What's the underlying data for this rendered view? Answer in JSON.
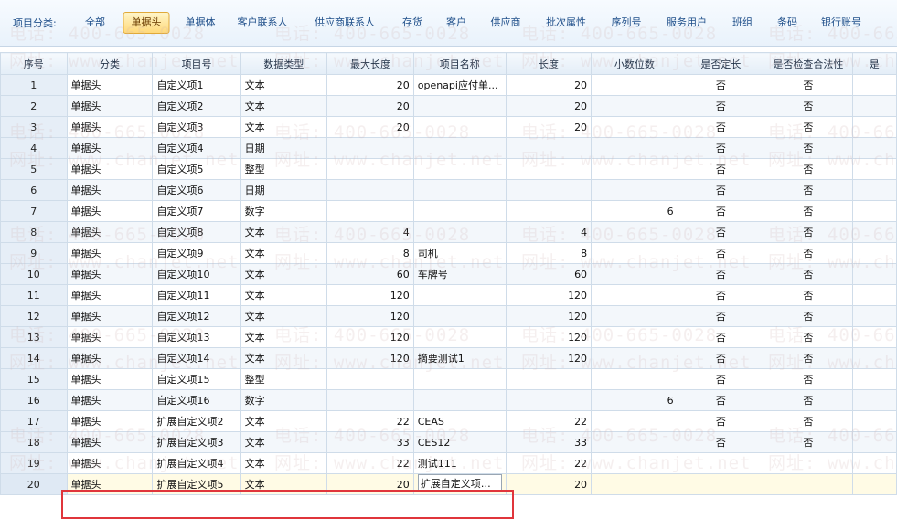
{
  "category_bar": {
    "label": "项目分类:",
    "items": [
      {
        "label": "全部",
        "active": false
      },
      {
        "label": "单据头",
        "active": true
      },
      {
        "label": "单据体",
        "active": false
      },
      {
        "label": "客户联系人",
        "active": false
      },
      {
        "label": "供应商联系人",
        "active": false
      },
      {
        "label": "存货",
        "active": false
      },
      {
        "label": "客户",
        "active": false
      },
      {
        "label": "供应商",
        "active": false
      },
      {
        "label": "批次属性",
        "active": false
      },
      {
        "label": "序列号",
        "active": false
      },
      {
        "label": "服务用户",
        "active": false
      },
      {
        "label": "班组",
        "active": false
      },
      {
        "label": "条码",
        "active": false
      },
      {
        "label": "银行账号",
        "active": false
      }
    ]
  },
  "grid": {
    "columns": [
      "序号",
      "分类",
      "项目号",
      "数据类型",
      "最大长度",
      "项目名称",
      "长度",
      "小数位数",
      "是否定长",
      "是否检查合法性",
      "是"
    ],
    "rows": [
      [
        "1",
        "单据头",
        "自定义项1",
        "文本",
        "20",
        "openapi应付单...",
        "20",
        "",
        "否",
        "否"
      ],
      [
        "2",
        "单据头",
        "自定义项2",
        "文本",
        "20",
        "",
        "20",
        "",
        "否",
        "否"
      ],
      [
        "3",
        "单据头",
        "自定义项3",
        "文本",
        "20",
        "",
        "20",
        "",
        "否",
        "否"
      ],
      [
        "4",
        "单据头",
        "自定义项4",
        "日期",
        "",
        "",
        "",
        "",
        "否",
        "否"
      ],
      [
        "5",
        "单据头",
        "自定义项5",
        "整型",
        "",
        "",
        "",
        "",
        "否",
        "否"
      ],
      [
        "6",
        "单据头",
        "自定义项6",
        "日期",
        "",
        "",
        "",
        "",
        "否",
        "否"
      ],
      [
        "7",
        "单据头",
        "自定义项7",
        "数字",
        "",
        "",
        "",
        "6",
        "否",
        "否"
      ],
      [
        "8",
        "单据头",
        "自定义项8",
        "文本",
        "4",
        "",
        "4",
        "",
        "否",
        "否"
      ],
      [
        "9",
        "单据头",
        "自定义项9",
        "文本",
        "8",
        "司机",
        "8",
        "",
        "否",
        "否"
      ],
      [
        "10",
        "单据头",
        "自定义项10",
        "文本",
        "60",
        "车牌号",
        "60",
        "",
        "否",
        "否"
      ],
      [
        "11",
        "单据头",
        "自定义项11",
        "文本",
        "120",
        "",
        "120",
        "",
        "否",
        "否"
      ],
      [
        "12",
        "单据头",
        "自定义项12",
        "文本",
        "120",
        "",
        "120",
        "",
        "否",
        "否"
      ],
      [
        "13",
        "单据头",
        "自定义项13",
        "文本",
        "120",
        "",
        "120",
        "",
        "否",
        "否"
      ],
      [
        "14",
        "单据头",
        "自定义项14",
        "文本",
        "120",
        "摘要测试1",
        "120",
        "",
        "否",
        "否"
      ],
      [
        "15",
        "单据头",
        "自定义项15",
        "整型",
        "",
        "",
        "",
        "",
        "否",
        "否"
      ],
      [
        "16",
        "单据头",
        "自定义项16",
        "数字",
        "",
        "",
        "",
        "6",
        "否",
        "否"
      ],
      [
        "17",
        "单据头",
        "扩展自定义项2",
        "文本",
        "22",
        "CEAS",
        "22",
        "",
        "否",
        "否"
      ],
      [
        "18",
        "单据头",
        "扩展自定义项3",
        "文本",
        "33",
        "CES12",
        "33",
        "",
        "否",
        "否"
      ],
      [
        "19",
        "单据头",
        "扩展自定义项4",
        "文本",
        "22",
        "测试111",
        "22",
        "",
        "",
        ""
      ],
      [
        "20",
        "单据头",
        "扩展自定义项5",
        "文本",
        "20",
        "扩展自定义项应...",
        "20",
        "",
        "",
        ""
      ]
    ],
    "selected_row": 19
  },
  "watermark": {
    "phone": "电话: 400-665-0028",
    "site": "网址: www.chanjet.net"
  },
  "colors": {
    "accent_text": "#1f4f8a",
    "active_tab": "#ffd97a",
    "highlight_box": "#e0353b"
  }
}
